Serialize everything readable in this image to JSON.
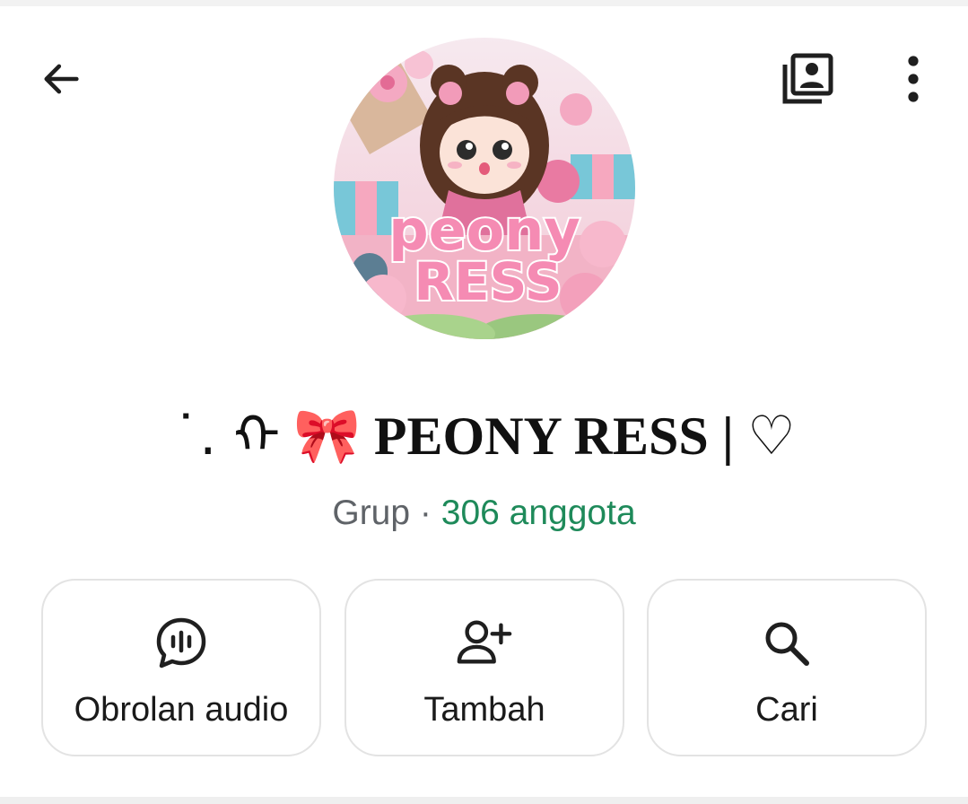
{
  "header": {
    "back_icon": "arrow-left-icon",
    "media_icon": "media-gallery-icon",
    "more_icon": "more-vertical-icon"
  },
  "avatar": {
    "logo_line1": "peony",
    "logo_line2": "RESS"
  },
  "group": {
    "name_prefix": "˙. ᡣ",
    "name_emoji": "🎀",
    "name": "PEONY RESS | ♡",
    "type": "Grup",
    "separator": "·",
    "members": "306 anggota"
  },
  "actions": [
    {
      "label": "Obrolan audio",
      "icon": "audio-chat-icon"
    },
    {
      "label": "Tambah",
      "icon": "add-person-icon"
    },
    {
      "label": "Cari",
      "icon": "search-icon"
    }
  ],
  "colors": {
    "members_accent": "#1e8a5a",
    "secondary_text": "#5f6368",
    "card_border": "#e3e3e3"
  }
}
